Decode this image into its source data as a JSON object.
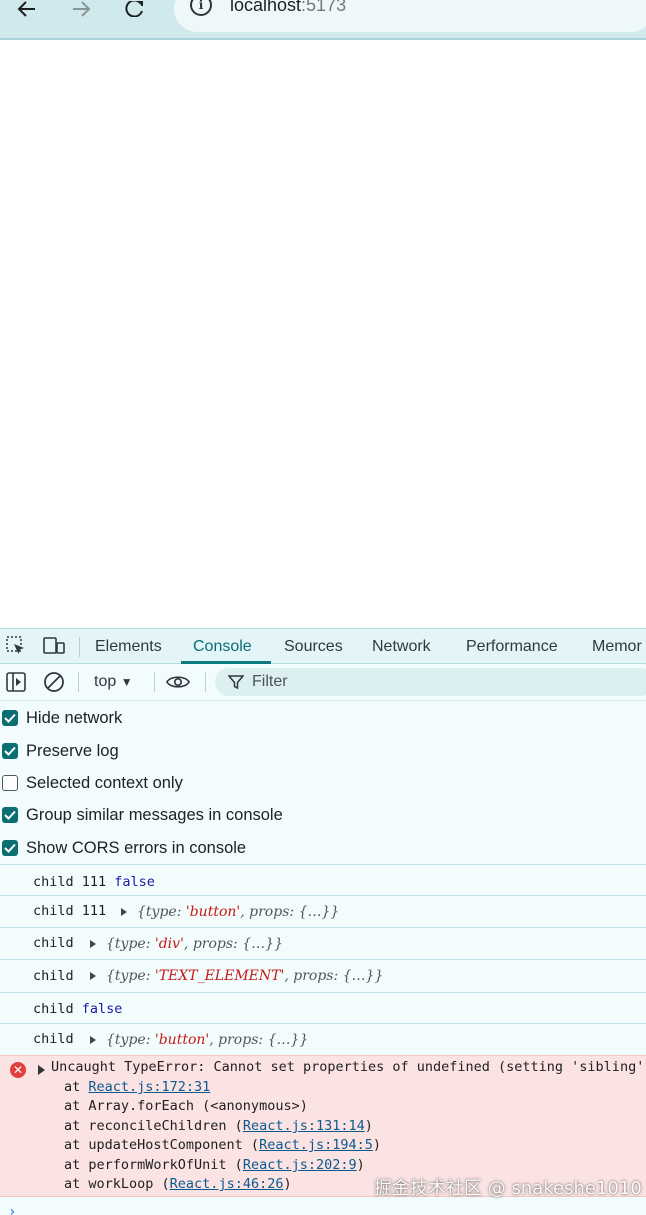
{
  "browser": {
    "url_host": "localhost",
    "url_port": ":5173",
    "icons": [
      "back-icon",
      "forward-icon",
      "reload-icon",
      "site-info-icon"
    ]
  },
  "devtools": {
    "tabs": [
      "Elements",
      "Console",
      "Sources",
      "Network",
      "Performance",
      "Memor"
    ],
    "active_tab": "Console",
    "context": "top",
    "filter_placeholder": "Filter",
    "settings": [
      {
        "label": "Hide network",
        "checked": true
      },
      {
        "label": "Preserve log",
        "checked": true
      },
      {
        "label": "Selected context only",
        "checked": false
      },
      {
        "label": "Group similar messages in console",
        "checked": true
      },
      {
        "label": "Show CORS errors in console",
        "checked": true
      }
    ],
    "messages": [
      {
        "text": "child 111",
        "value": "false"
      },
      {
        "text": "child 111",
        "obj_type": "'button'"
      },
      {
        "text": "child",
        "obj_type": "'div'"
      },
      {
        "text": "child",
        "obj_type": "'TEXT_ELEMENT'"
      },
      {
        "text": "child",
        "value": "false"
      },
      {
        "text": "child",
        "obj_type": "'button'"
      }
    ],
    "obj": {
      "type_key": "type: ",
      "props_key": "props: ",
      "ellipsis": "{…}",
      "open": "{",
      "close": "}",
      "sep": ", "
    },
    "error": {
      "headline": "Uncaught TypeError: Cannot set properties of undefined (setting 'sibling')",
      "stack": [
        {
          "prefix": "at ",
          "link": "React.js:172:31"
        },
        {
          "prefix": "at Array.forEach (<anonymous>)",
          "link": ""
        },
        {
          "prefix": "at reconcileChildren (",
          "link": "React.js:131:14",
          "suffix": ")"
        },
        {
          "prefix": "at updateHostComponent (",
          "link": "React.js:194:5",
          "suffix": ")"
        },
        {
          "prefix": "at performWorkOfUnit (",
          "link": "React.js:202:9",
          "suffix": ")"
        },
        {
          "prefix": "at workLoop (",
          "link": "React.js:46:26",
          "suffix": ")"
        }
      ]
    }
  },
  "watermark": "掘金技术社区 @ snakeshe1010"
}
